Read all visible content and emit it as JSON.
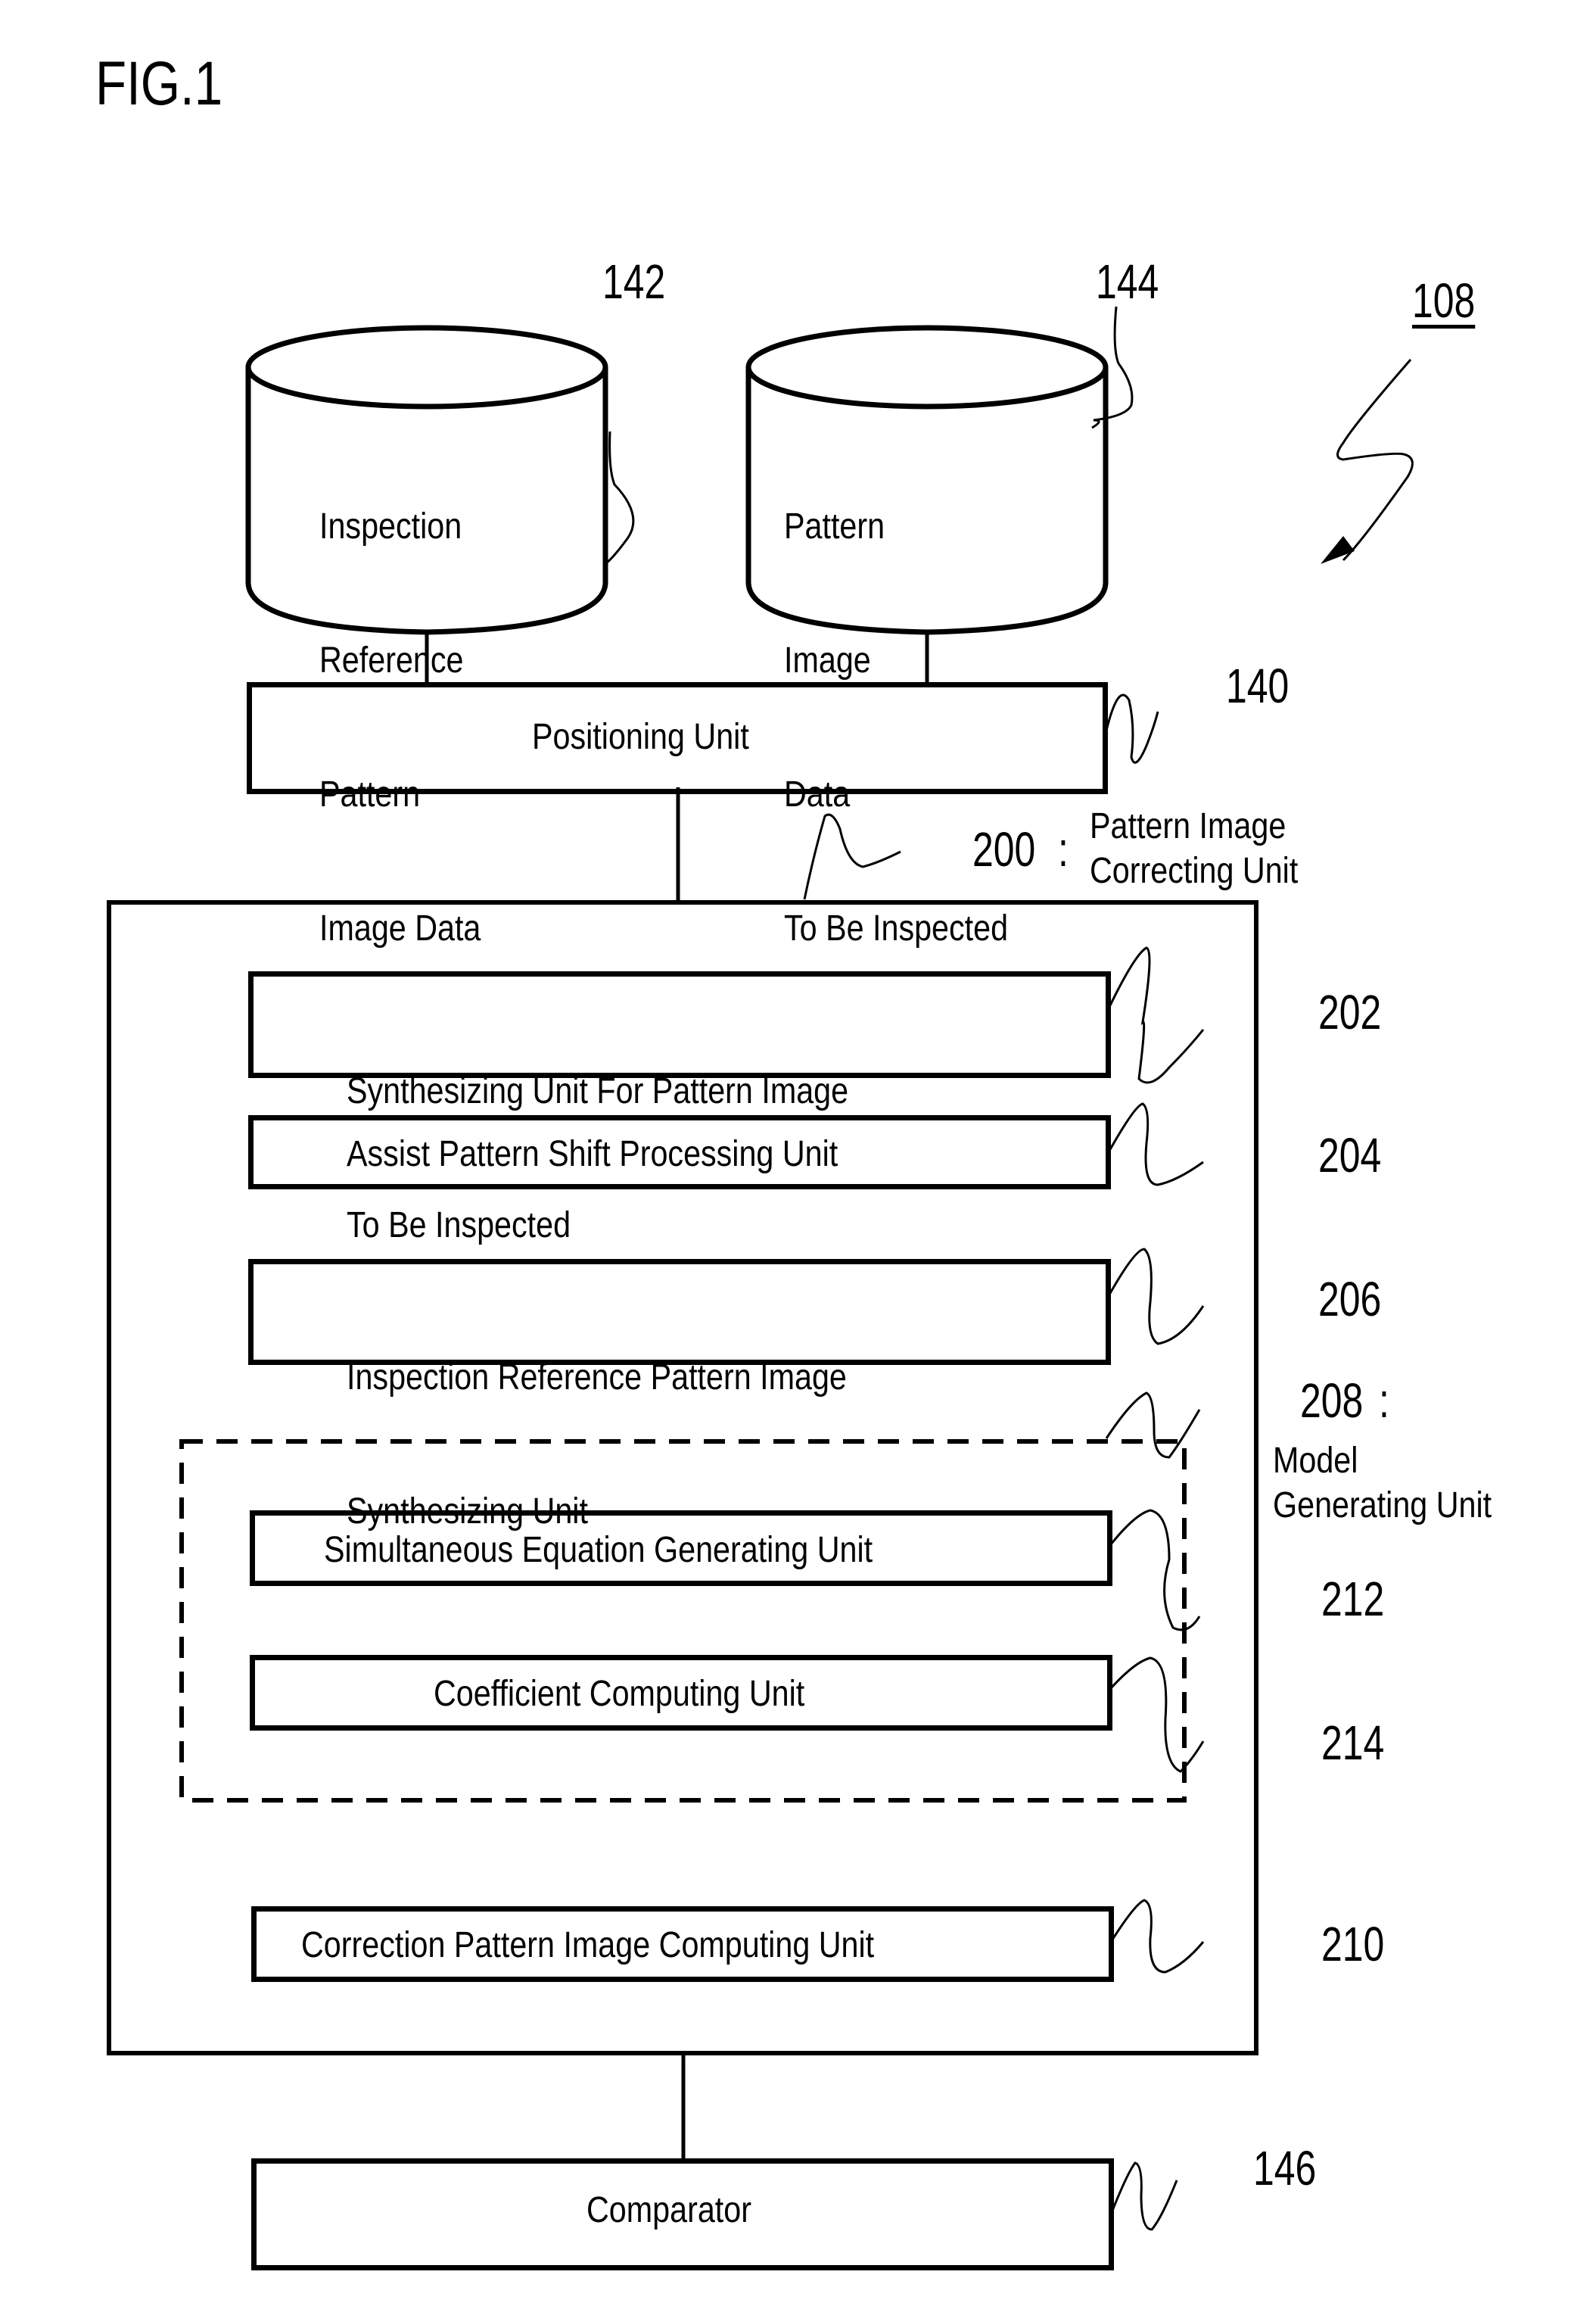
{
  "figure": {
    "title": "FIG.1",
    "system_ref": "108"
  },
  "databases": [
    {
      "ref": "142",
      "lines": [
        "Inspection",
        "Reference",
        "Pattern",
        "Image Data"
      ]
    },
    {
      "ref": "144",
      "lines": [
        "Pattern",
        "Image",
        "Data",
        "To Be Inspected"
      ]
    }
  ],
  "positioning_unit": {
    "ref": "140",
    "label": "Positioning Unit"
  },
  "correcting_unit": {
    "ref": "200",
    "separator": ":",
    "label_lines": [
      "Pattern Image",
      "Correcting Unit"
    ],
    "blocks": [
      {
        "ref": "202",
        "lines": [
          "Synthesizing Unit For Pattern Image",
          "To Be Inspected"
        ]
      },
      {
        "ref": "204",
        "lines": [
          "Assist Pattern Shift Processing Unit"
        ]
      },
      {
        "ref": "206",
        "lines": [
          "Inspection Reference Pattern Image",
          "Synthesizing Unit"
        ]
      }
    ],
    "model_generating_unit": {
      "ref": "208",
      "separator": ":",
      "label_lines": [
        "Model",
        "Generating Unit"
      ],
      "blocks": [
        {
          "ref": "212",
          "label": "Simultaneous Equation Generating Unit"
        },
        {
          "ref": "214",
          "label": "Coefficient Computing Unit"
        }
      ]
    },
    "correction_block": {
      "ref": "210",
      "label": "Correction Pattern Image Computing Unit"
    }
  },
  "comparator": {
    "ref": "146",
    "label": "Comparator"
  }
}
